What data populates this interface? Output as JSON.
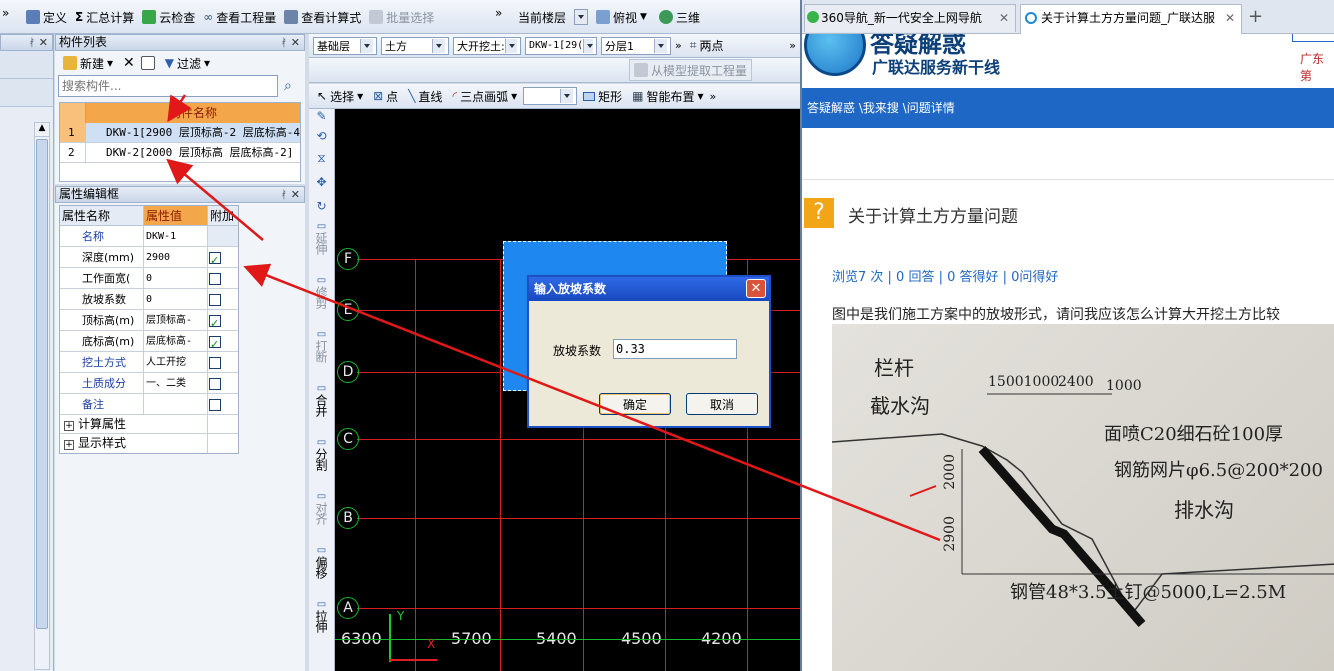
{
  "toolbar1": {
    "items": [
      "定义",
      "汇总计算",
      "云检查",
      "查看工程量",
      "查看计算式",
      "批量选择"
    ],
    "more": "»",
    "floor_label": "当前楼层",
    "view": "俯视",
    "three_d": "三维"
  },
  "toolbar2": {
    "floor": "基础层",
    "category": "土方",
    "type": "大开挖土:",
    "component": "DKW-1[29(",
    "layer": "分层1",
    "two_point": "两点",
    "extract": "从模型提取工程量"
  },
  "toolbar3": {
    "select": "选择",
    "point": "点",
    "line": "直线",
    "arc": "三点画弧",
    "rect": "矩形",
    "smart": "智能布置"
  },
  "component_list": {
    "title": "构件列表",
    "new_label": "新建",
    "filter_label": "过滤",
    "search_placeholder": "搜索构件...",
    "column": "构件名称",
    "rows": [
      {
        "n": "1",
        "name": "DKW-1[2900 层顶标高-2 层底标高-4"
      },
      {
        "n": "2",
        "name": "DKW-2[2000 层顶标高 层底标高-2]"
      }
    ]
  },
  "property_panel": {
    "title": "属性编辑框",
    "headers": [
      "属性名称",
      "属性值",
      "附加"
    ],
    "rows": [
      {
        "name": "名称",
        "value": "DKW-1",
        "check": null,
        "blue": true
      },
      {
        "name": "深度(mm)",
        "value": "2900",
        "check": true,
        "blue": false
      },
      {
        "name": "工作面宽(",
        "value": "0",
        "check": false,
        "blue": false
      },
      {
        "name": "放坡系数",
        "value": "0",
        "check": false,
        "blue": false
      },
      {
        "name": "顶标高(m)",
        "value": "层顶标高-",
        "check": true,
        "blue": false
      },
      {
        "name": "底标高(m)",
        "value": "层底标高-",
        "check": true,
        "blue": false
      },
      {
        "name": "挖土方式",
        "value": "人工开挖",
        "check": false,
        "blue": true
      },
      {
        "name": "土质成分",
        "value": "一、二类",
        "check": false,
        "blue": true
      },
      {
        "name": "备注",
        "value": "",
        "check": false,
        "blue": true
      }
    ],
    "groups": [
      "计算属性",
      "显示样式"
    ]
  },
  "left_tools": [
    "延伸",
    "修剪",
    "打断",
    "合并",
    "分割",
    "对齐",
    "偏移",
    "拉伸"
  ],
  "canvas": {
    "axes_y": [
      "F",
      "E",
      "D",
      "C",
      "B",
      "A"
    ],
    "dims": [
      "6300",
      "5700",
      "5400",
      "4500",
      "4200"
    ],
    "axis_x_label": "X",
    "axis_y_label": "Y"
  },
  "dialog": {
    "title": "输入放坡系数",
    "label": "放坡系数",
    "value": "0.33",
    "ok": "确定",
    "cancel": "取消"
  },
  "browser": {
    "tabs": [
      "360导航_新一代安全上网导航",
      "关于计算土方方量问题_广联达服"
    ],
    "new_tab": "+",
    "site_title": "答疑解惑",
    "site_sub": "广联达服务新干线",
    "site_region": "广东第",
    "breadcrumb": "答疑解惑 \\我来搜 \\问题详情",
    "question_title": "关于计算土方方量问题",
    "stats": "浏览7 次 | 0 回答 | 0 答得好 | 0问得好",
    "question_text": "图中是我们施工方案中的放坡形式，请问我应该怎么计算大开挖土方比较",
    "photo_labels": [
      "栏杆",
      "截水沟",
      "15001000",
      "2400",
      "1000",
      "面喷C20细石砼100厚",
      "钢筋网片φ6.5@200*200",
      "排水沟",
      "2000",
      "2900",
      "钢管48*3.5土钉@5000,L=2.5M"
    ]
  },
  "colors": {
    "accent": "#1f67c4",
    "grid": "#d32020",
    "axis": "#17b62b",
    "selection": "#1e88f0",
    "arrow": "#e01818"
  }
}
